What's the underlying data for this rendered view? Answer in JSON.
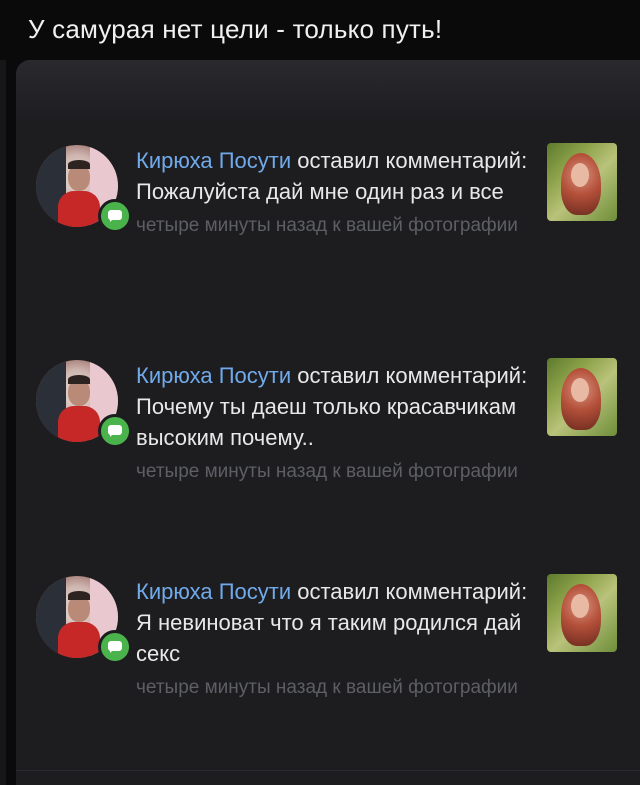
{
  "post": {
    "title": "У самурая нет цели - только путь!"
  },
  "notifications": [
    {
      "author": "Кирюха Посути",
      "action": "оставил комментарий:",
      "comment": "Пожалуйста дай мне один раз и все",
      "meta": "четыре минуты назад к вашей фотографии"
    },
    {
      "author": "Кирюха Посути",
      "action": "оставил комментарий:",
      "comment": "Почему ты даеш только красавчикам высоким почему..",
      "meta": "четыре минуты назад к вашей фотографии"
    },
    {
      "author": "Кирюха Посути",
      "action": "оставил комментарий:",
      "comment": "Я невиноват что я таким родился дай секс",
      "meta": "четыре минуты назад к вашей фотографии"
    }
  ],
  "colors": {
    "author_link": "#71aaeb",
    "badge": "#4bb34b",
    "meta": "#5d5f64"
  },
  "icons": {
    "badge": "comment-badge-icon"
  }
}
